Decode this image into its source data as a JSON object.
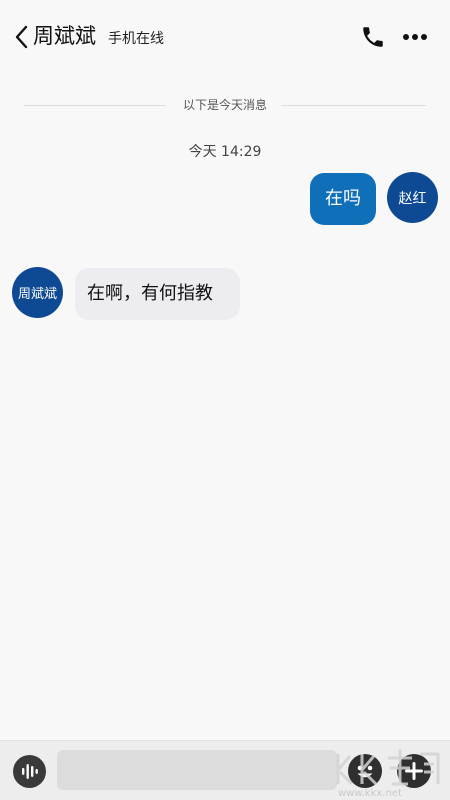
{
  "header": {
    "contact_name": "周斌斌",
    "contact_status": "手机在线"
  },
  "chat": {
    "divider_text": "以下是今天消息",
    "timestamp": "今天 14:29",
    "messages": [
      {
        "direction": "out",
        "sender_avatar_text": "赵红",
        "text": "在吗"
      },
      {
        "direction": "in",
        "sender_avatar_text": "周斌斌",
        "text": "在啊，有何指教"
      }
    ]
  },
  "composer": {
    "input_value": "",
    "placeholder": ""
  },
  "watermark": {
    "text": "www.kkx.net"
  },
  "colors": {
    "outgoing_bubble": "#0f6fb8",
    "incoming_bubble": "#ececf1",
    "avatar_bg": "#0e4a93"
  },
  "icons": [
    "chevron-left-icon",
    "phone-icon",
    "more-icon",
    "voice-icon",
    "emoji-icon",
    "plus-icon"
  ]
}
